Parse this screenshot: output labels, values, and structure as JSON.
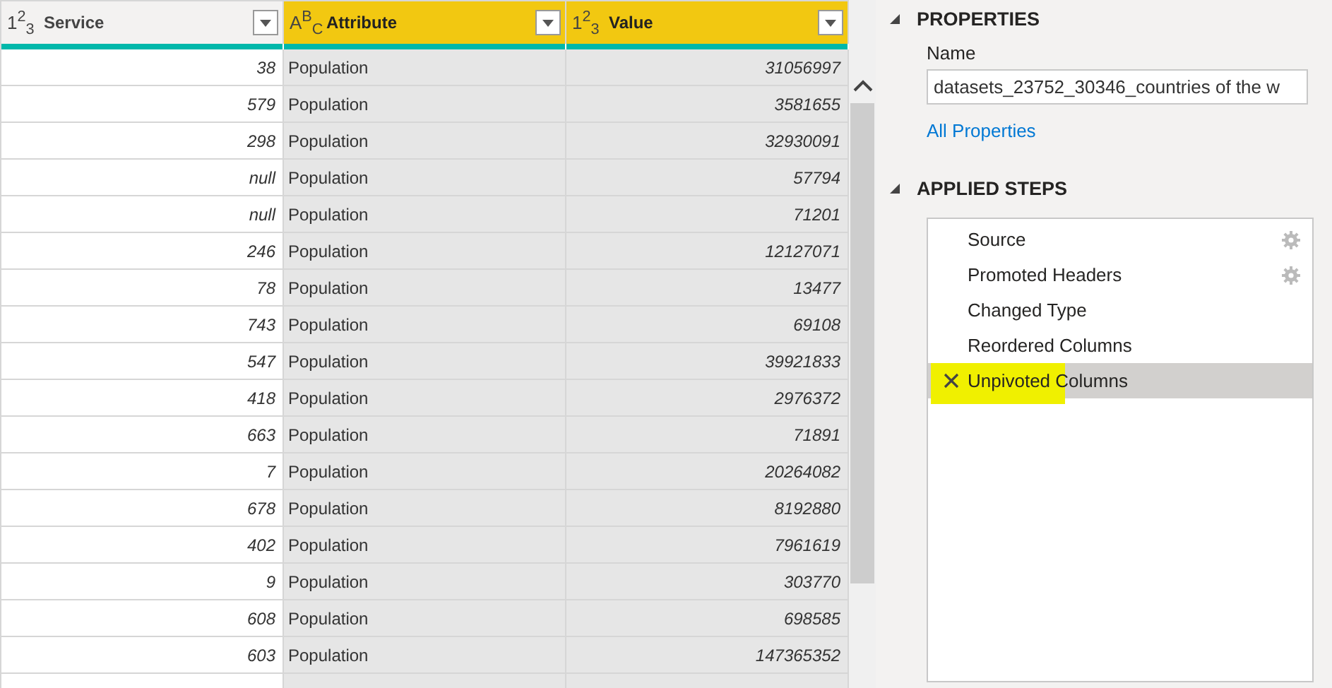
{
  "table": {
    "columns": [
      {
        "type_label": "1$^{2}$$_{3}$",
        "name": "Service",
        "selected": false
      },
      {
        "type_label": "A$^{B}$$_{C}$",
        "name": "Attribute",
        "selected": true
      },
      {
        "type_label": "1$^{2}$$_{3}$",
        "name": "Value",
        "selected": true
      }
    ],
    "rows": [
      [
        "38",
        "Population",
        "31056997"
      ],
      [
        "579",
        "Population",
        "3581655"
      ],
      [
        "298",
        "Population",
        "32930091"
      ],
      [
        "null",
        "Population",
        "57794"
      ],
      [
        "null",
        "Population",
        "71201"
      ],
      [
        "246",
        "Population",
        "12127071"
      ],
      [
        "78",
        "Population",
        "13477"
      ],
      [
        "743",
        "Population",
        "69108"
      ],
      [
        "547",
        "Population",
        "39921833"
      ],
      [
        "418",
        "Population",
        "2976372"
      ],
      [
        "663",
        "Population",
        "71891"
      ],
      [
        "7",
        "Population",
        "20264082"
      ],
      [
        "678",
        "Population",
        "8192880"
      ],
      [
        "402",
        "Population",
        "7961619"
      ],
      [
        "9",
        "Population",
        "303770"
      ],
      [
        "608",
        "Population",
        "698585"
      ],
      [
        "603",
        "Population",
        "147365352"
      ]
    ]
  },
  "properties": {
    "title": "PROPERTIES",
    "name_label": "Name",
    "name_value": "datasets_23752_30346_countries of the w",
    "link": "All Properties"
  },
  "applied_steps": {
    "title": "APPLIED STEPS",
    "steps": [
      {
        "name": "Source",
        "has_settings": true,
        "selected": false,
        "highlighted": false
      },
      {
        "name": "Promoted Headers",
        "has_settings": true,
        "selected": false,
        "highlighted": false
      },
      {
        "name": "Changed Type",
        "has_settings": false,
        "selected": false,
        "highlighted": false
      },
      {
        "name": "Reordered Columns",
        "has_settings": false,
        "selected": false,
        "highlighted": false
      },
      {
        "name": "Unpivoted Columns",
        "has_settings": false,
        "selected": true,
        "highlighted": true
      }
    ]
  }
}
